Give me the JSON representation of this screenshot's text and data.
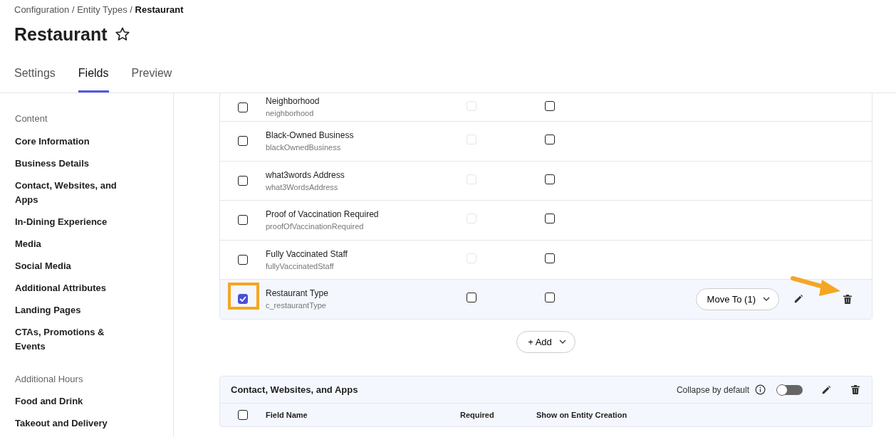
{
  "breadcrumb": {
    "items": [
      "Configuration",
      "Entity Types"
    ],
    "separator": "/",
    "current": "Restaurant"
  },
  "page_title": "Restaurant",
  "favorite": false,
  "tabs": [
    {
      "label": "Settings",
      "selected": false
    },
    {
      "label": "Fields",
      "selected": true
    },
    {
      "label": "Preview",
      "selected": false
    }
  ],
  "sidebar": {
    "items": [
      {
        "kind": "heading",
        "label": "Content"
      },
      {
        "kind": "link",
        "label": "Core Information"
      },
      {
        "kind": "link",
        "label": "Business Details"
      },
      {
        "kind": "link",
        "label": "Contact, Websites, and Apps"
      },
      {
        "kind": "link",
        "label": "In-Dining Experience"
      },
      {
        "kind": "link",
        "label": "Media"
      },
      {
        "kind": "link",
        "label": "Social Media"
      },
      {
        "kind": "link",
        "label": "Additional Attributes"
      },
      {
        "kind": "link",
        "label": "Landing Pages"
      },
      {
        "kind": "link",
        "label": "CTAs, Promotions & Events"
      },
      {
        "kind": "heading",
        "label": "Additional Hours"
      },
      {
        "kind": "link",
        "label": "Food and Drink"
      },
      {
        "kind": "link",
        "label": "Takeout and Delivery"
      }
    ]
  },
  "field_rows": [
    {
      "name": "Neighborhood",
      "api_name": "neighborhood",
      "selected": false,
      "required": false,
      "required_disabled": true,
      "show_on_creation": false
    },
    {
      "name": "Black-Owned Business",
      "api_name": "blackOwnedBusiness",
      "selected": false,
      "required": false,
      "required_disabled": true,
      "show_on_creation": false
    },
    {
      "name": "what3words Address",
      "api_name": "what3WordsAddress",
      "selected": false,
      "required": false,
      "required_disabled": true,
      "show_on_creation": false
    },
    {
      "name": "Proof of Vaccination Required",
      "api_name": "proofOfVaccinationRequired",
      "selected": false,
      "required": false,
      "required_disabled": true,
      "show_on_creation": false
    },
    {
      "name": "Fully Vaccinated Staff",
      "api_name": "fullyVaccinatedStaff",
      "selected": false,
      "required": false,
      "required_disabled": true,
      "show_on_creation": false
    },
    {
      "name": "Restaurant Type",
      "api_name": "c_restaurantType",
      "selected": true,
      "required": false,
      "required_disabled": false,
      "show_on_creation": false,
      "highlighted": true,
      "move_button": "Move To (1)",
      "arrow_to_delete": true
    }
  ],
  "add_button": "+ Add",
  "section": {
    "title": "Contact, Websites, and Apps",
    "collapse_label": "Collapse by default",
    "collapse_by_default": false,
    "columns": [
      "Field Name",
      "Required",
      "Show on Entity Creation"
    ],
    "all_selected": false
  }
}
